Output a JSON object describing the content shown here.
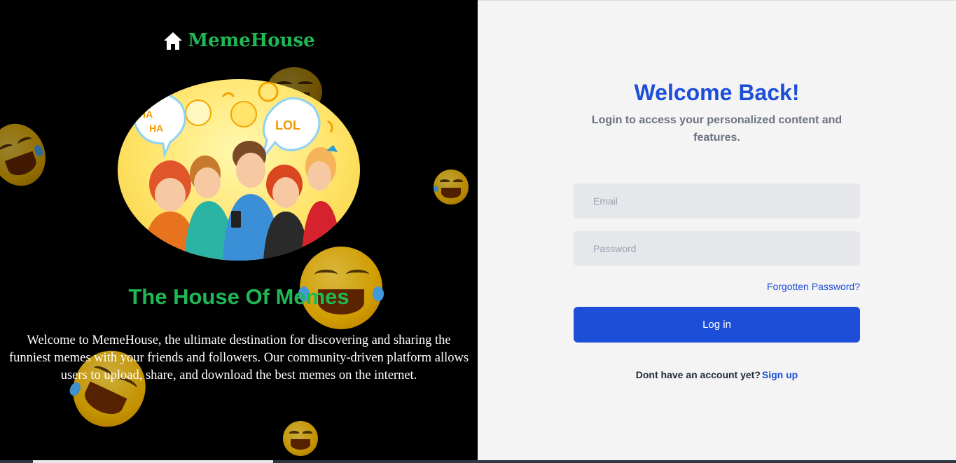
{
  "brand": {
    "name": "MemeHouse",
    "accent_color": "#1fb954",
    "icon": "home-icon"
  },
  "hero": {
    "headline": "The House Of Memes",
    "intro": "Welcome to MemeHouse, the ultimate destination for discovering and sharing the funniest memes with your friends and followers. Our community-driven platform allows users to upload, share, and download the best memes on the internet.",
    "bubble_left": "HA HA !",
    "bubble_right": "LOL"
  },
  "login": {
    "title": "Welcome Back!",
    "subtitle": "Login to access your personalized content and features.",
    "email_placeholder": "Email",
    "password_placeholder": "Password",
    "forgot_label": "Forgotten Password?",
    "login_label": "Log in",
    "no_account_text": "Dont have an account yet?",
    "signup_label": "Sign up",
    "primary_color": "#1d4ed8"
  },
  "decorations": {
    "emoji_icon": "laughing-emoji-icon"
  }
}
